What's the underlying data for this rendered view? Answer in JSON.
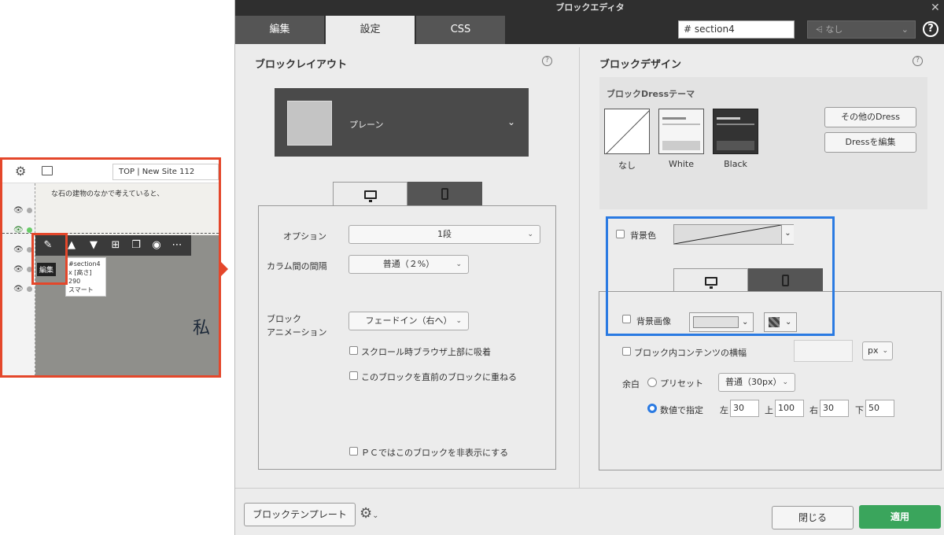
{
  "left_editor": {
    "page_select": "TOP | New Site 112",
    "content_text": "な石の建物のなかで考えていると、",
    "big_char": "私",
    "toolbar_tooltip": "編集",
    "block_info": [
      "#section4",
      "x [高さ] 290",
      "スマート"
    ]
  },
  "dialog": {
    "title": "ブロックエディタ",
    "tabs": [
      "編集",
      "設定",
      "CSS"
    ],
    "active_tab": "設定",
    "id_field": "section4",
    "id_prefix": "#",
    "class_select": "なし",
    "layout": {
      "title": "ブロックレイアウト",
      "layout_name": "プレーン",
      "option_label": "オプション",
      "option_value": "1段",
      "column_gap_label": "カラム間の間隔",
      "column_gap_value": "普通（２%）",
      "animation_label_1": "ブロック",
      "animation_label_2": "アニメーション",
      "animation_value": "フェードイン（右へ）",
      "check_scroll": "スクロール時ブラウザ上部に吸着",
      "check_overlap": "このブロックを直前のブロックに重ねる",
      "check_hide_pc": "ＰＣではこのブロックを非表示にする"
    },
    "design": {
      "title": "ブロックデザイン",
      "dress_theme_label": "ブロックDressテーマ",
      "dress_options": [
        "なし",
        "White",
        "Black"
      ],
      "other_dress_button": "その他のDress",
      "edit_dress_button": "Dressを編集",
      "bg_color_label": "背景色",
      "bg_image_label": "背景画像",
      "content_width_label": "ブロック内コンテンツの横幅",
      "unit_value": "px",
      "margin_label": "余白",
      "preset_label": "プリセット",
      "preset_value": "普通（30px）",
      "numeric_label": "数値で指定",
      "margins": {
        "left_label": "左",
        "left": "30",
        "top_label": "上",
        "top": "100",
        "right_label": "右",
        "right": "30",
        "bottom_label": "下",
        "bottom": "50"
      }
    },
    "footer": {
      "template_button": "ブロックテンプレート",
      "close_button": "閉じる",
      "apply_button": "適用"
    }
  },
  "colors": {
    "highlight_red": "#e4472b",
    "highlight_blue": "#2a7ae2",
    "apply_green": "#3aa55c"
  }
}
